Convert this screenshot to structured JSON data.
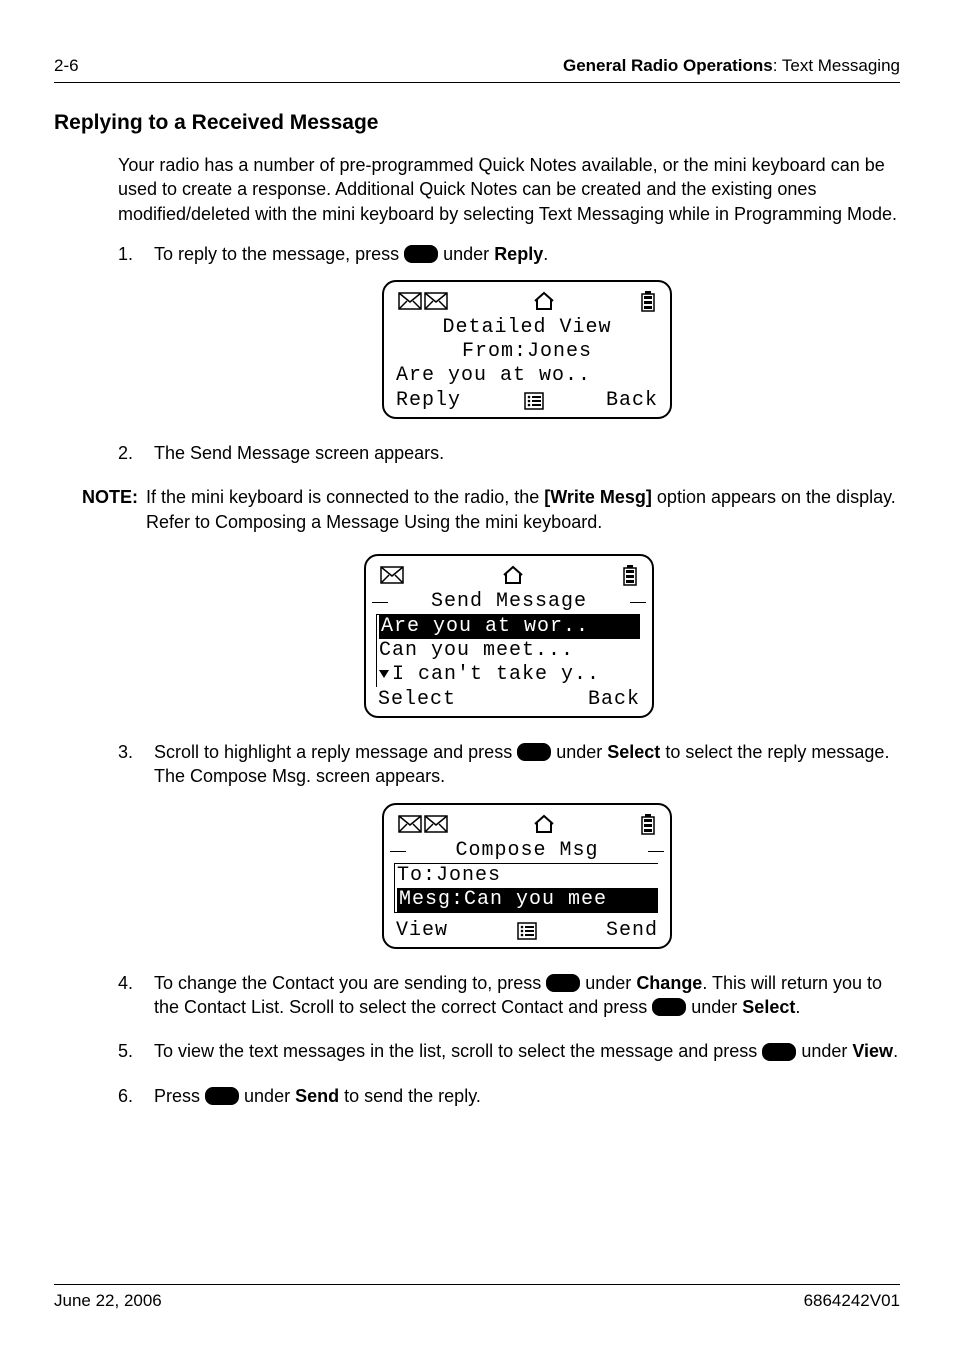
{
  "header": {
    "page_num": "2-6",
    "right_bold": "General Radio Operations",
    "right_rest": ": Text Messaging"
  },
  "section_title": "Replying to a Received Message",
  "intro": "Your radio has a number of pre-programmed Quick Notes available, or the mini keyboard can be used to create a response. Additional Quick Notes can be created and the existing ones modified/deleted with the mini keyboard by selecting Text Messaging while in Programming Mode.",
  "steps": {
    "s1a": "To reply to the message, press ",
    "s1b": " under ",
    "s1c": "Reply",
    "s1d": ".",
    "s2": "The Send Message screen appears.",
    "s3a": "Scroll to highlight a reply message and press ",
    "s3b": " under ",
    "s3c": "Select",
    "s3d": " to select the reply message. The Compose Msg. screen appears.",
    "s4a": "To change the Contact you are sending to, press ",
    "s4b": " under ",
    "s4c": "Change",
    "s4d": ". This will return you to the Contact List. Scroll to select the correct Contact and press ",
    "s4e": " under ",
    "s4f": "Select",
    "s4g": ".",
    "s5a": "To view the text messages in the list, scroll to select the message and press ",
    "s5b": " under ",
    "s5c": "View",
    "s5d": ".",
    "s6a": "Press ",
    "s6b": " under ",
    "s6c": "Send",
    "s6d": " to send the reply."
  },
  "note": {
    "label": "NOTE:",
    "text": "If the mini keyboard is connected to the radio, the [Write Mesg] option appears on the display. Refer to Composing a Message Using the mini keyboard.",
    "bold": "[Write Mesg]"
  },
  "screen1": {
    "title": "Detailed View",
    "line2": "From:Jones",
    "line3": "Are you at wo..",
    "soft_left": "Reply",
    "soft_right": "Back"
  },
  "screen2": {
    "title": "Send Message",
    "opt1": "Are you at wor..",
    "opt2": "Can you meet...",
    "opt3": "I can't take y..",
    "soft_left": "Select",
    "soft_right": "Back"
  },
  "screen3": {
    "title": "Compose Msg",
    "line1": "To:Jones",
    "line2": "Mesg:Can you mee",
    "soft_left": "View",
    "soft_right": "Send"
  },
  "footer": {
    "date": "June 22, 2006",
    "doc": "6864242V01"
  }
}
